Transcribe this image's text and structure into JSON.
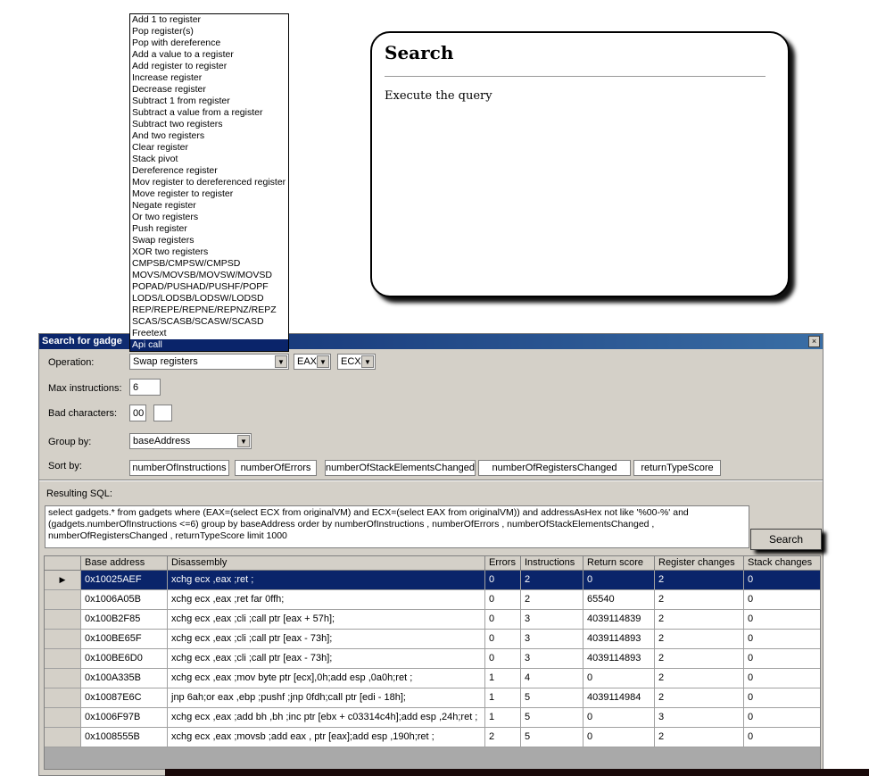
{
  "tooltip": {
    "title": "Search",
    "body": "Execute the query"
  },
  "operation_list": [
    "Add 1 to register",
    "Pop register(s)",
    "Pop with dereference",
    "Add a value to a register",
    "Add register to register",
    "Increase register",
    "Decrease register",
    "Subtract 1 from register",
    "Subtract a value from a register",
    "Subtract two registers",
    "And two registers",
    "Clear register",
    "Stack pivot",
    "Dereference register",
    "Mov register to dereferenced register",
    "Move register to register",
    "Negate register",
    "Or two registers",
    "Push register",
    "Swap registers",
    "XOR two registers",
    "CMPSB/CMPSW/CMPSD",
    "MOVS/MOVSB/MOVSW/MOVSD",
    "POPAD/PUSHAD/PUSHF/POPF",
    "LODS/LODSB/LODSW/LODSD",
    "REP/REPE/REPNE/REPNZ/REPZ",
    "SCAS/SCASB/SCASW/SCASD",
    "Freetext",
    "Api call"
  ],
  "operation_list_selected": 28,
  "dialog": {
    "title": "Search for gadge",
    "close_glyph": "×",
    "operation_label": "Operation:",
    "operation_value": "Swap registers",
    "reg1_value": "EAX",
    "reg2_value": "ECX",
    "max_instr_label": "Max instructions:",
    "max_instr_value": "6",
    "bad_chars_label": "Bad characters:",
    "bad_chars_value1": "00",
    "bad_chars_value2": "",
    "group_label": "Group by:",
    "group_value": "baseAddress",
    "sort_label": "Sort by:",
    "sort_fields": [
      "numberOfInstructions",
      "numberOfErrors",
      "numberOfStackElementsChanged",
      "numberOfRegistersChanged",
      "returnTypeScore"
    ],
    "sql_label": "Resulting SQL:",
    "sql_text": "select  gadgets.* from gadgets where (EAX=(select ECX from originalVM) and ECX=(select EAX from originalVM))  and addressAsHex not like '%00-%'  and (gadgets.numberOfInstructions <=6)  group by baseAddress order by numberOfInstructions , numberOfErrors , numberOfStackElementsChanged , numberOfRegistersChanged , returnTypeScore limit 1000",
    "search_label": "Search",
    "row_pointer": "▶"
  },
  "grid": {
    "columns": [
      "",
      "Base address",
      "Disassembly",
      "Errors",
      "Instructions",
      "Return score",
      "Register changes",
      "Stack changes"
    ],
    "rows": [
      [
        "0x10025AEF",
        "xchg ecx ,eax ;ret ;",
        "0",
        "2",
        "0",
        "2",
        "0"
      ],
      [
        "0x1006A05B",
        "xchg ecx ,eax ;ret far 0ffh;",
        "0",
        "2",
        "65540",
        "2",
        "0"
      ],
      [
        "0x100B2F85",
        "xchg ecx ,eax ;cli ;call  ptr [eax + 57h];",
        "0",
        "3",
        "4039114839",
        "2",
        "0"
      ],
      [
        "0x100BE65F",
        "xchg ecx ,eax ;cli ;call  ptr [eax - 73h];",
        "0",
        "3",
        "4039114893",
        "2",
        "0"
      ],
      [
        "0x100BE6D0",
        "xchg ecx ,eax ;cli ;call  ptr [eax - 73h];",
        "0",
        "3",
        "4039114893",
        "2",
        "0"
      ],
      [
        "0x100A335B",
        "xchg ecx ,eax ;mov byte ptr [ecx],0h;add esp ,0a0h;ret ;",
        "1",
        "4",
        "0",
        "2",
        "0"
      ],
      [
        "0x10087E6C",
        "jnp 6ah;or eax ,ebp ;pushf ;jnp 0fdh;call  ptr [edi - 18h];",
        "1",
        "5",
        "4039114984",
        "2",
        "0"
      ],
      [
        "0x1006F97B",
        "xchg ecx ,eax ;add bh ,bh ;inc  ptr [ebx + c03314c4h];add esp ,24h;ret ;",
        "1",
        "5",
        "0",
        "3",
        "0"
      ],
      [
        "0x1008555B",
        "xchg ecx ,eax ;movsb ;add eax , ptr [eax];add esp ,190h;ret ;",
        "2",
        "5",
        "0",
        "2",
        "0"
      ]
    ],
    "selected_row": 0
  }
}
